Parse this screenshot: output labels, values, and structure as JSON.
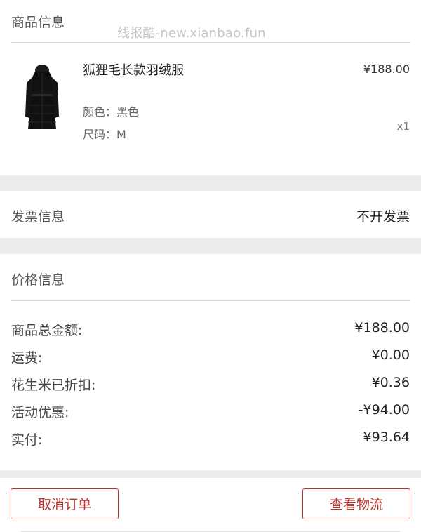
{
  "watermark": "线报酷-new.xianbao.fun",
  "product_section": {
    "title": "商品信息",
    "item": {
      "name": "狐狸毛长款羽绒服",
      "color": "颜色：黑色",
      "size": "尺码：M",
      "price": "¥188.00",
      "quantity": "x1"
    }
  },
  "invoice_section": {
    "title": "发票信息",
    "value": "不开发票"
  },
  "price_section": {
    "title": "价格信息",
    "rows": [
      {
        "label": "商品总金额:",
        "value": "¥188.00"
      },
      {
        "label": "运费:",
        "value": "¥0.00"
      },
      {
        "label": "花生米已折扣:",
        "value": "¥0.36"
      },
      {
        "label": "活动优惠:",
        "value": "-¥94.00"
      },
      {
        "label": "实付:",
        "value": "¥93.64"
      }
    ]
  },
  "actions": {
    "cancel_label": "取消订单",
    "logistics_label": "查看物流"
  },
  "colors": {
    "accent": "#b8322e",
    "background": "#ededed"
  }
}
